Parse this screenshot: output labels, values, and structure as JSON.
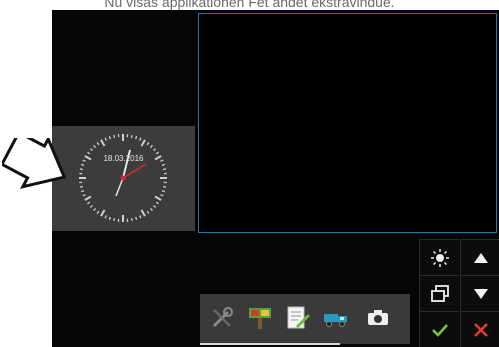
{
  "caption": "Nu visas applikationen Fet andet ekstravindue.",
  "clock": {
    "date": "18.03.2016"
  },
  "side_controls": [
    {
      "name": "brightness-icon"
    },
    {
      "name": "arrow-up-icon"
    },
    {
      "name": "window-switch-icon"
    },
    {
      "name": "arrow-down-icon"
    },
    {
      "name": "confirm-check-icon"
    },
    {
      "name": "cancel-x-icon"
    }
  ],
  "taskbar": [
    {
      "name": "tools-wrench-icon"
    },
    {
      "name": "map-sign-icon"
    },
    {
      "name": "notepad-pencil-icon"
    },
    {
      "name": "truck-icon"
    },
    {
      "name": "camera-icon"
    }
  ],
  "colors": {
    "viewport_border": "#1b78b0",
    "confirm": "#7cc33a",
    "cancel": "#e23a2f",
    "second_hand": "#d8283a"
  }
}
